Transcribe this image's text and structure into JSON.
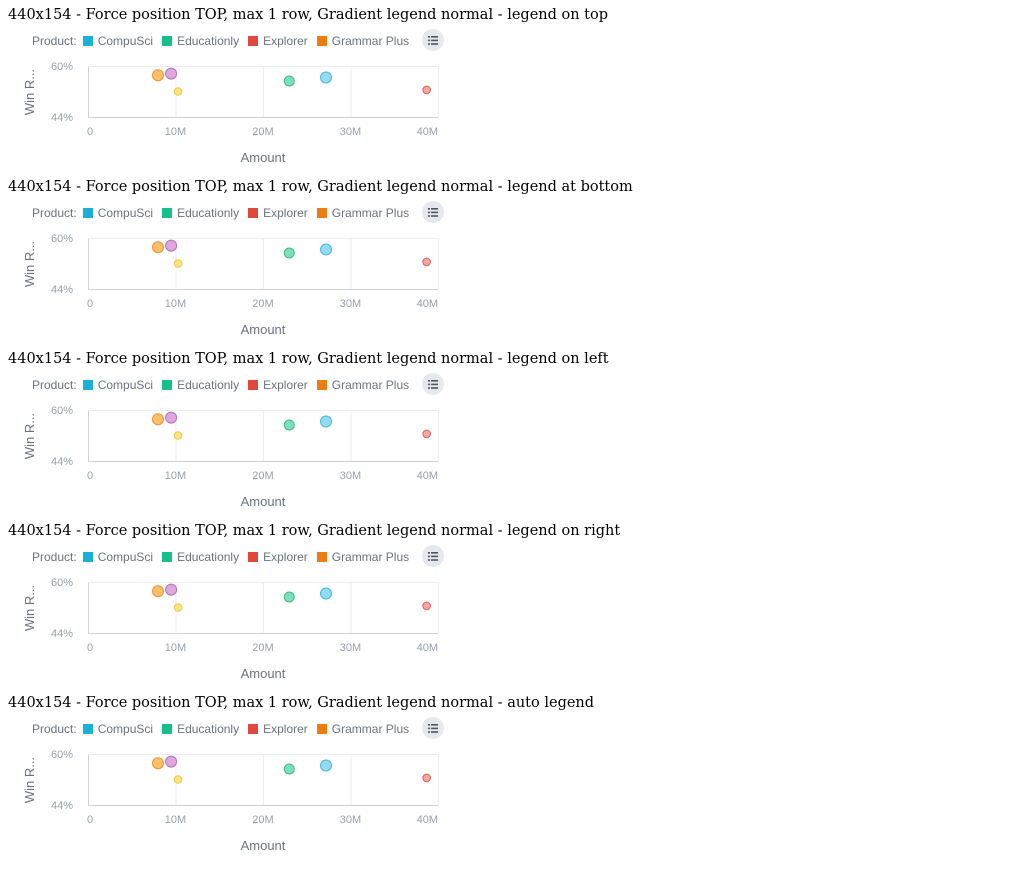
{
  "sections": [
    {
      "title": "440x154 - Force position TOP, max 1 row, Gradient legend normal - legend on top"
    },
    {
      "title": "440x154 - Force position TOP, max 1 row, Gradient legend normal - legend at bottom"
    },
    {
      "title": "440x154 - Force position TOP, max 1 row, Gradient legend normal - legend on left"
    },
    {
      "title": "440x154 - Force position TOP, max 1 row, Gradient legend normal - legend on right"
    },
    {
      "title": "440x154 - Force position TOP, max 1 row, Gradient legend normal - auto legend"
    }
  ],
  "legend": {
    "label": "Product:",
    "items": [
      {
        "label": "CompuSci",
        "color": "#1aafd6"
      },
      {
        "label": "Educationly",
        "color": "#15c08a"
      },
      {
        "label": "Explorer",
        "color": "#e0483b"
      },
      {
        "label": "Grammar Plus",
        "color": "#ef7c0e"
      }
    ],
    "more_icon": "list-icon"
  },
  "chart_data": {
    "type": "scatter",
    "xlabel": "Amount",
    "ylabel": "Win R...",
    "x_ticks": [
      "0",
      "10M",
      "20M",
      "30M",
      "40M"
    ],
    "y_ticks": [
      "60%",
      "44%"
    ],
    "xlim": [
      0,
      40000000
    ],
    "ylim": [
      44,
      60
    ],
    "grid": true,
    "legend_position": "top",
    "points": [
      {
        "x": 8000000,
        "y": 57.1,
        "size": "large",
        "fill": "#ffbe6b",
        "stroke": "#e8952e"
      },
      {
        "x": 9500000,
        "y": 57.6,
        "size": "large",
        "fill": "#e1a5e0",
        "stroke": "#a97bb1"
      },
      {
        "x": 10300000,
        "y": 52.0,
        "size": "small",
        "fill": "#ffe27a",
        "stroke": "#e8c84a"
      },
      {
        "x": 23000000,
        "y": 55.3,
        "size": "medium",
        "fill": "#7ee0b8",
        "stroke": "#3fb98a"
      },
      {
        "x": 27200000,
        "y": 56.4,
        "size": "large",
        "fill": "#92dcf2",
        "stroke": "#49b7d9"
      },
      {
        "x": 38700000,
        "y": 52.5,
        "size": "small",
        "fill": "#f5a7a0",
        "stroke": "#d8665c"
      }
    ]
  }
}
